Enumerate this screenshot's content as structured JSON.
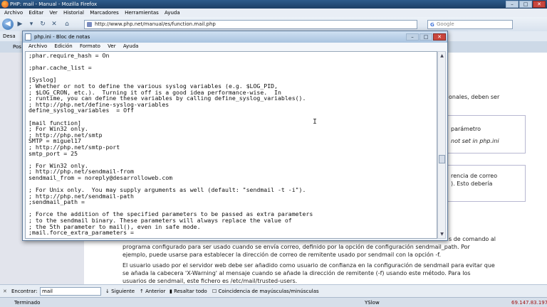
{
  "firefox": {
    "title": "PHP: mail - Manual - Mozilla Firefox",
    "menu": [
      "Archivo",
      "Editar",
      "Ver",
      "Historial",
      "Marcadores",
      "Herramientas",
      "Ayuda"
    ],
    "url": "http://www.php.net/manual/es/function.mail.php",
    "search_placeholder": "Google",
    "bookmarks_label": "Desa",
    "tab_label": "Pos",
    "find_label": "Encontrar:",
    "find_value": "mail",
    "find_next": "Siguiente",
    "find_prev": "Anterior",
    "find_highlight": "Resaltar todo",
    "find_match_case": "Coincidencia de mayúsculas/minúsculas",
    "status": "Terminado",
    "status_vslow": "YSlow",
    "status_ip": "69.147.83.197"
  },
  "page": {
    "frag1": "onales, deben ser",
    "frag2": "parámetro",
    "frag3": "not set in php.ini",
    "frag4": "rencia de correo",
    "frag5": "). Esto debería",
    "frag6": "s de comando al",
    "line1": "programa configurado para ser usado cuando se envía correo, definido por la opción de configuración sendmail_path. Por",
    "line2": "ejemplo, puede usarse para establecer la dirección de correo de remitente usado por sendmail con la opción -f.",
    "line3": "El usuario usado por el servidor web debe ser añadido como usuario de confianza en la configuración de sendmail para evitar que",
    "line4": "se añada la cabecera 'X-Warning' al mensaje cuando se añade la dirección de remitente (-f) usando este método. Para los",
    "line5": "usuarios de sendmail, este fichero es /etc/mail/trusted-users."
  },
  "notepad": {
    "title": "php.ini - Bloc de notas",
    "menu": [
      "Archivo",
      "Edición",
      "Formato",
      "Ver",
      "Ayuda"
    ],
    "content": ";phar.require_hash = On\n\n;phar.cache_list =\n\n[Syslog]\n; Whether or not to define the various syslog variables (e.g. $LOG_PID,\n; $LOG_CRON, etc.).  Turning it off is a good idea performance-wise.  In\n; runtime, you can define these variables by calling define_syslog_variables().\n; http://php.net/define-syslog-variables\ndefine_syslog_variables  = Off\n\n[mail function]\n; For Win32 only.\n; http://php.net/smtp\nSMTP = miguel17\n; http://php.net/smtp-port\nsmtp_port = 25\n\n; For Win32 only.\n; http://php.net/sendmail-from\nsendmail_from = noreply@desarrolloweb.com\n\n; For Unix only.  You may supply arguments as well (default: \"sendmail -t -i\").\n; http://php.net/sendmail-path\n;sendmail_path =\n\n; Force the addition of the specified parameters to be passed as extra parameters\n; to the sendmail binary. These parameters will always replace the value of\n; the 5th parameter to mail(), even in safe mode.\n;mail.force_extra_parameters =\n\n; Add X-PHP-Originating-Script: that will include uid of the script followed by the filename\nmail.add_x_header = On"
  }
}
